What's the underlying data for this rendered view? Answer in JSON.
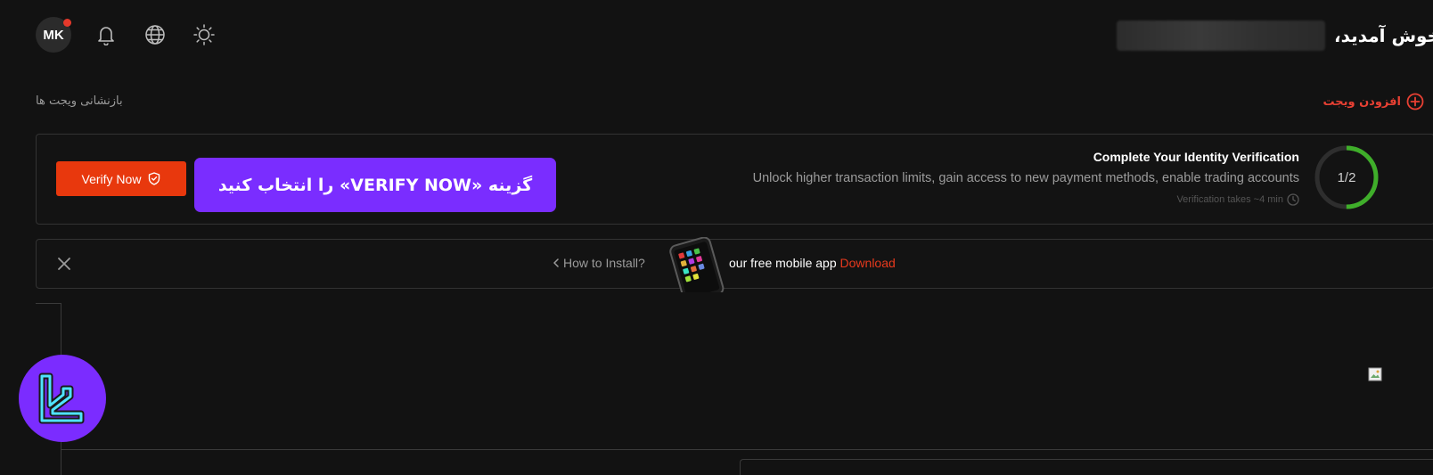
{
  "header": {
    "avatar_initials": "MK",
    "welcome_text": "خوش آمدید،",
    "icons": [
      "bell-icon",
      "globe-icon",
      "sun-icon"
    ]
  },
  "widgets": {
    "add_label": "افزودن ویجت",
    "reset_label": "بازنشانی ویجت ها"
  },
  "verification": {
    "title": "Complete Your Identity Verification",
    "description": "Unlock higher transaction limits, gain access to new payment methods, enable trading accounts",
    "time_note": "Verification takes ~4 min",
    "progress_label": "1/2",
    "progress_fraction": 0.5,
    "button_label": "Verify Now",
    "tooltip": "گزینه «VERIFY NOW» را انتخاب کنید"
  },
  "app_banner": {
    "how_to_install": "How to Install?",
    "text": "our free mobile app",
    "download_label": "Download"
  },
  "colors": {
    "accent_red": "#e8380d",
    "tooltip_purple": "#7a2dff",
    "progress_green": "#3fae2a",
    "background": "#121212"
  }
}
